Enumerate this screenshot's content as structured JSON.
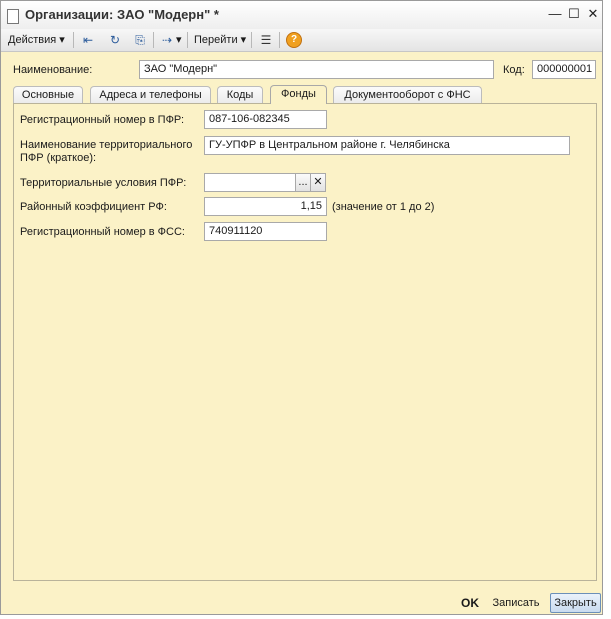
{
  "window": {
    "title": "Организации: ЗАО \"Модерн\" *",
    "minimize_glyph": "—",
    "maximize_glyph": "☐",
    "close_glyph": "✕"
  },
  "toolbar": {
    "actions_label": "Действия",
    "goto_label": "Перейти",
    "dropdown_glyph": "▾",
    "help_glyph": "?"
  },
  "header": {
    "name_label": "Наименование:",
    "name_value": "ЗАО \"Модерн\"",
    "code_label": "Код:",
    "code_value": "000000001"
  },
  "tabs": [
    {
      "label": "Основные"
    },
    {
      "label": "Адреса и телефоны"
    },
    {
      "label": "Коды"
    },
    {
      "label": "Фонды"
    },
    {
      "label": "Документооборот с ФНС"
    }
  ],
  "active_tab": "Фонды",
  "form": {
    "pfr_reg_label": "Регистрационный номер в ПФР:",
    "pfr_reg_value": "087-106-082345",
    "pfr_name_label_line1": "Наименование территориального",
    "pfr_name_label_line2": "ПФР (краткое):",
    "pfr_name_value": "ГУ-УПФР в Центральном районе г. Челябинска",
    "pfr_terr_label": "Территориальные условия ПФР:",
    "pfr_terr_value": "",
    "select_glyph": "...",
    "clear_glyph": "✕",
    "coef_label": "Районный коэффициент РФ:",
    "coef_value": "1,15",
    "coef_hint": "(значение от 1 до 2)",
    "fss_reg_label": "Регистрационный номер в  ФСС:",
    "fss_reg_value": "740911120"
  },
  "footer": {
    "ok_label": "OK",
    "save_label": "Записать",
    "close_label": "Закрыть"
  },
  "colors": {
    "form_background": "#fbf2c7",
    "primary_button": "#c9dbef"
  }
}
